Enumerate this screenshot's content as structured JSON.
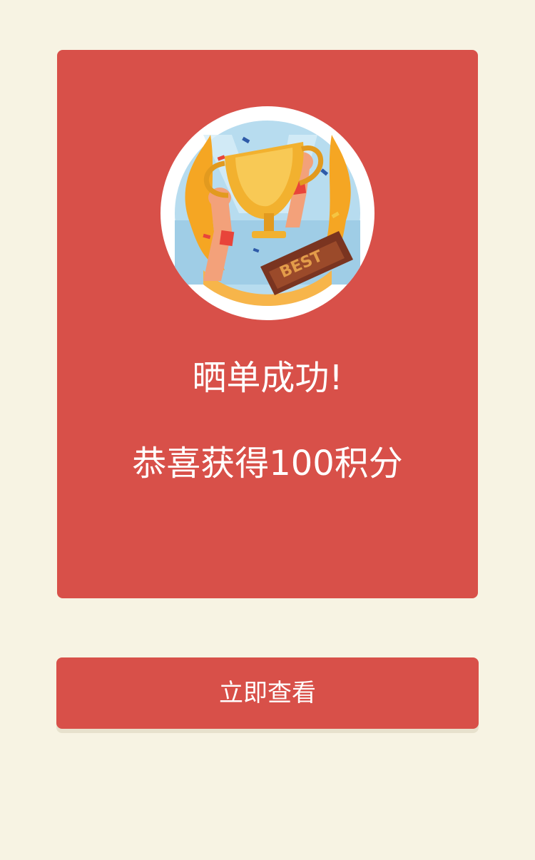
{
  "result": {
    "title": "晒单成功!",
    "message": "恭喜获得100积分"
  },
  "trophy_badge": {
    "plaque_text": "BEST"
  },
  "actions": {
    "view_now_label": "立即查看"
  },
  "colors": {
    "page_background": "#f7f3e3",
    "card_background": "#d85049",
    "button_background": "#d85049",
    "text": "#ffffff"
  }
}
